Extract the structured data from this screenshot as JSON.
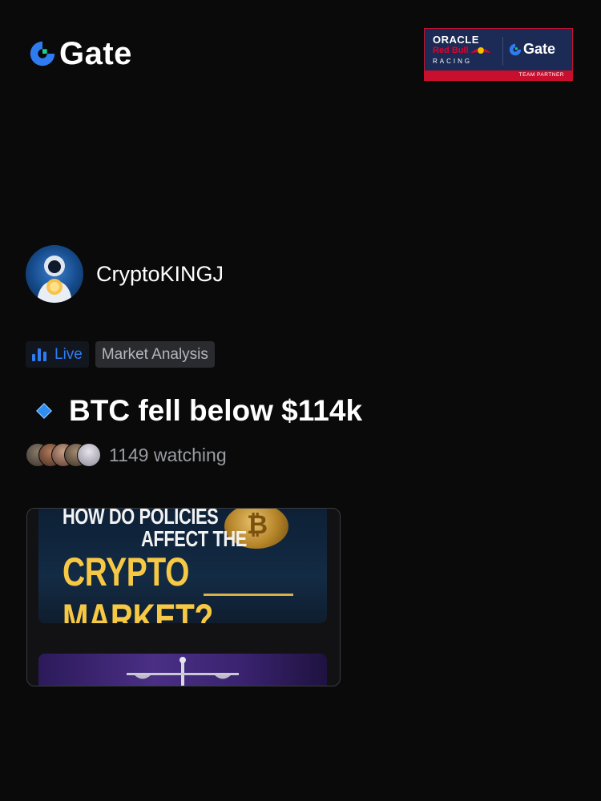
{
  "brand": {
    "logo_text": "Gate",
    "accent": "#2f7bf0"
  },
  "partner_banner": {
    "oracle": "ORACLE",
    "redbull": "Red Bull",
    "racing": "RACING",
    "gate": "Gate",
    "footer": "TEAM PARTNER"
  },
  "author": {
    "name": "CryptoKINGJ"
  },
  "tags": {
    "live": "Live",
    "category": "Market Analysis"
  },
  "post": {
    "title": "BTC fell below $114k"
  },
  "viewers": {
    "count_text": "1149 watching"
  },
  "thumbnail": {
    "line1": "HOW DO POLICIES",
    "line2": "AFFECT THE",
    "line3": "CRYPTO MARKET?",
    "coin_symbol": "₿"
  }
}
